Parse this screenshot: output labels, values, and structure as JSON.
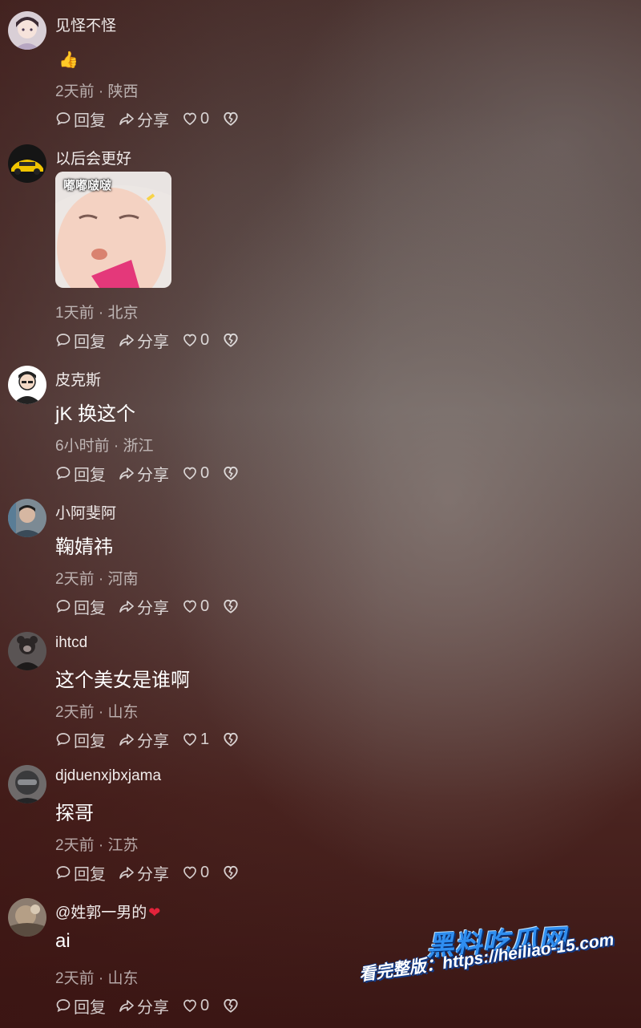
{
  "comments": [
    {
      "username": "见怪不怪",
      "emoji": "👍",
      "text": "",
      "time": "2天前",
      "location": "陕西",
      "reply_label": "回复",
      "share_label": "分享",
      "likes": "0",
      "avatar": "anime-girl-avatar"
    },
    {
      "username": "以后会更好",
      "text": "",
      "sticker_caption": "嘟嘟啵啵",
      "time": "1天前",
      "location": "北京",
      "reply_label": "回复",
      "share_label": "分享",
      "likes": "0",
      "avatar": "yellow-car-avatar"
    },
    {
      "username": "皮克斯",
      "text": "jK 换这个",
      "time": "6小时前",
      "location": "浙江",
      "reply_label": "回复",
      "share_label": "分享",
      "likes": "0",
      "avatar": "cartoon-man-avatar"
    },
    {
      "username": "小阿斐阿",
      "text": "鞠婧祎",
      "time": "2天前",
      "location": "河南",
      "reply_label": "回复",
      "share_label": "分享",
      "likes": "0",
      "avatar": "man-photo-avatar"
    },
    {
      "username": "ihtcd",
      "text": "这个美女是谁啊",
      "time": "2天前",
      "location": "山东",
      "reply_label": "回复",
      "share_label": "分享",
      "likes": "1",
      "avatar": "dark-figure-avatar"
    },
    {
      "username": "djduenxjbxjama",
      "text": "探哥",
      "time": "2天前",
      "location": "江苏",
      "reply_label": "回复",
      "share_label": "分享",
      "likes": "0",
      "avatar": "helmet-avatar"
    },
    {
      "username": "@姓郭一男的",
      "username_suffix": "❤",
      "text": "ai",
      "time": "2天前",
      "location": "山东",
      "reply_label": "回复",
      "share_label": "分享",
      "likes": "0",
      "avatar": "blurry-photo-avatar"
    }
  ],
  "meta_separator": "·",
  "watermark": {
    "logo": "黑料吃瓜网",
    "url": "看完整版：https://heiliao-15.com"
  },
  "colors": {
    "heart_red": "#e3233b",
    "watermark_blue": "#2f8ef0"
  }
}
